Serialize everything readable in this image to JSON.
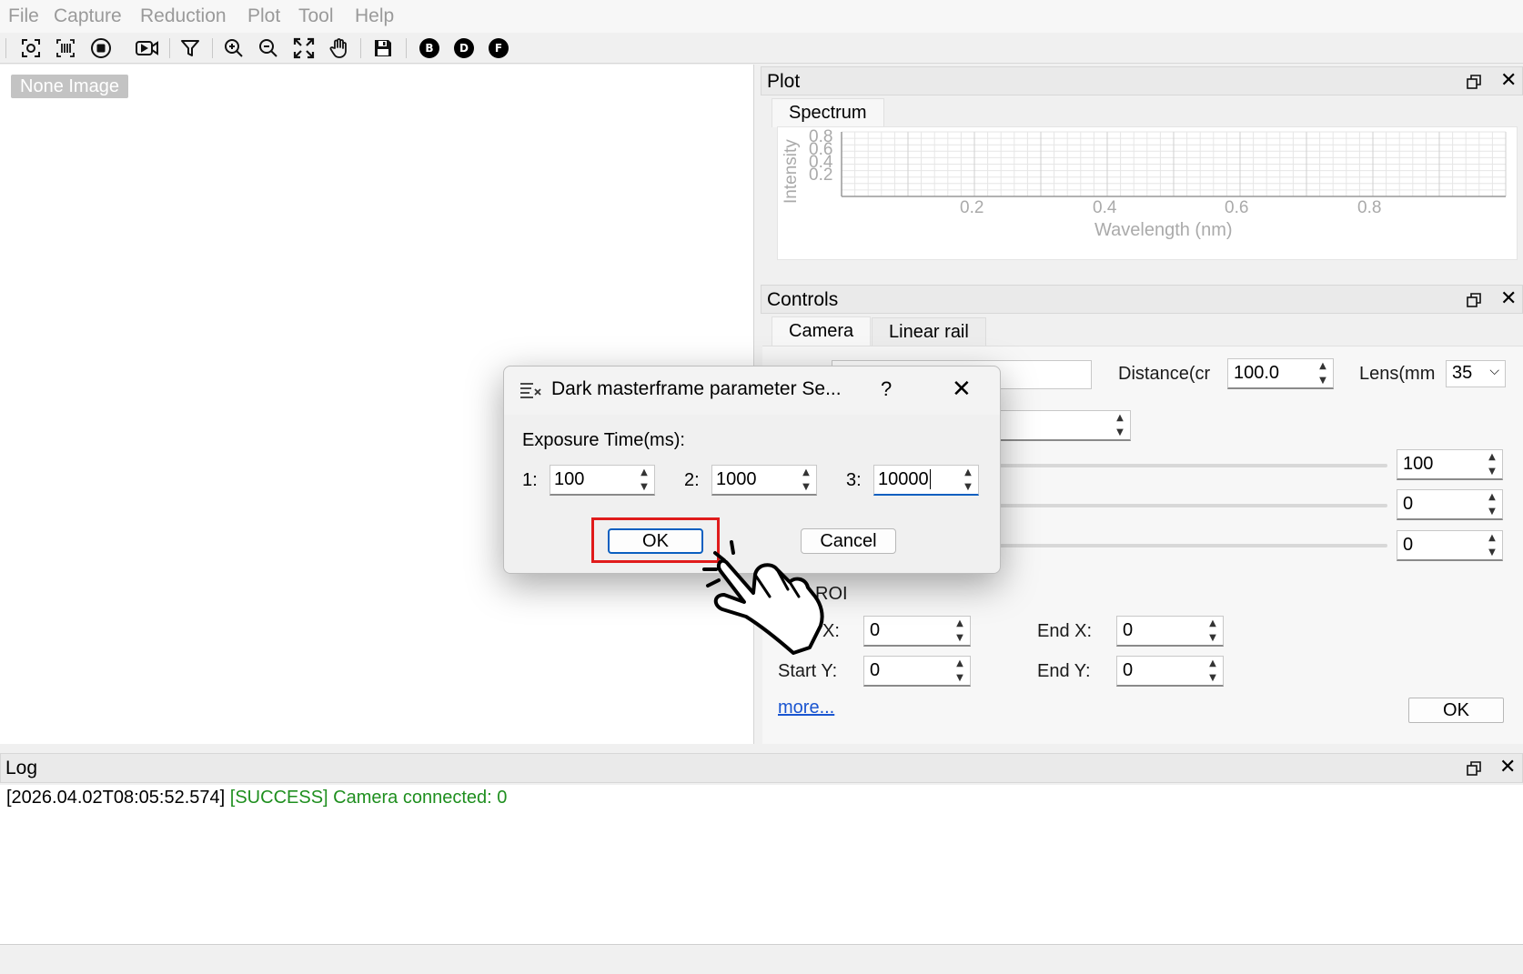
{
  "menu": [
    "File",
    "Capture",
    "Reduction",
    "Plot",
    "Tool",
    "Help"
  ],
  "toolbar": {
    "icons": [
      "screenshot-capture-icon",
      "barcode-scan-icon",
      "stop-record-icon",
      "video-record-icon",
      "filter-icon",
      "zoom-in-icon",
      "zoom-out-icon",
      "fit-screen-icon",
      "pan-hand-icon",
      "save-icon",
      "bias-b-icon",
      "dark-d-icon",
      "flat-f-icon"
    ],
    "b_label": "B",
    "d_label": "D",
    "f_label": "F"
  },
  "image_area": {
    "placeholder": "None Image"
  },
  "plot_dock": {
    "title": "Plot",
    "tab": "Spectrum",
    "chart": {
      "ylabel": "Intensity",
      "xlabel": "Wavelength (nm)",
      "y_ticks": [
        "0.8",
        "0.6",
        "0.4",
        "0.2"
      ],
      "x_ticks": [
        "0.2",
        "0.4",
        "0.6",
        "0.8"
      ]
    }
  },
  "controls_dock": {
    "title": "Controls",
    "tabs": [
      "Camera",
      "Linear rail"
    ],
    "distance_label": "Distance(cr",
    "distance_value": "100.0",
    "lens_label": "Lens(mm",
    "lens_value": "35",
    "slider_values": [
      "100",
      "0",
      "0"
    ],
    "roi_label": "ROI",
    "start_x_label": "X:",
    "start_x_value": "0",
    "end_x_label": "End X:",
    "end_x_value": "0",
    "start_y_label": "Start Y:",
    "start_y_value": "0",
    "end_y_label": "End Y:",
    "end_y_value": "0",
    "more_link": "more...",
    "ok_label": "OK"
  },
  "log_dock": {
    "title": "Log",
    "timestamp": "[2026.04.02T08:05:52.574]",
    "status": "[SUCCESS]",
    "message": "Camera connected: 0",
    "success_color": "#1f8f1f"
  },
  "dialog": {
    "title": "Dark masterframe parameter Se...",
    "help": "?",
    "exposure_label": "Exposure Time(ms):",
    "fields": [
      {
        "label": "1:",
        "value": "100"
      },
      {
        "label": "2:",
        "value": "1000"
      },
      {
        "label": "3:",
        "value": "10000"
      }
    ],
    "ok_label": "OK",
    "cancel_label": "Cancel",
    "highlight_color": "#e01b1b"
  }
}
